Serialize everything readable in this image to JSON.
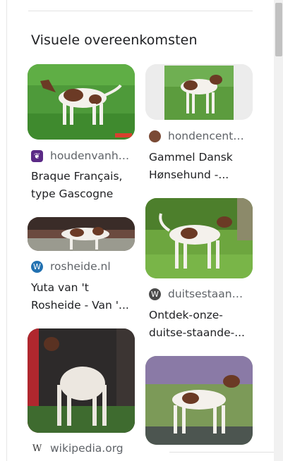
{
  "section": {
    "heading": "Visuele overeenkomsten"
  },
  "results": [
    {
      "source": "houdenvanhonden.nl",
      "title": "Braque Français, type Gascogne",
      "favicon": "houdenvanhonden-icon",
      "favicon_color": "#5b2a86"
    },
    {
      "source": "hondencentrum.nl",
      "title": "Gammel Dansk Hønsehund -...",
      "favicon": "hondencentrum-icon",
      "favicon_color": "#7a4a35"
    },
    {
      "source": "rosheide.nl",
      "title": "Yuta van 't Rosheide - Van '...",
      "favicon": "wordpress-icon",
      "favicon_color": "#2271b1"
    },
    {
      "source": "duitsestaandehond.nl",
      "title": "Ontdek-onze-duitse-staande-...",
      "favicon": "wordpress-icon",
      "favicon_color": "#4a4a4a"
    },
    {
      "source": "wikipedia.org",
      "title": "",
      "favicon": "wikipedia-icon",
      "favicon_color": "#333333"
    }
  ]
}
